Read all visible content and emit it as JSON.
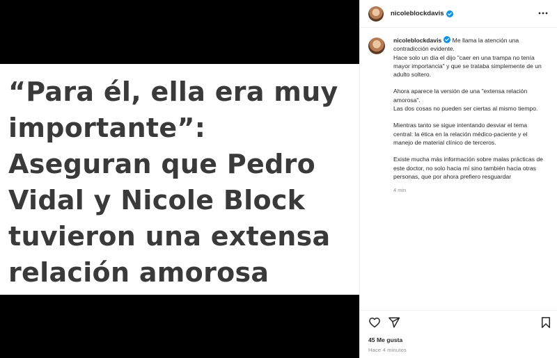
{
  "media": {
    "headline": "“Para él, ella era muy importante”: Aseguran que Pedro Vidal y Nicole Block tuvieron una extensa relación amorosa"
  },
  "header": {
    "username": "nicoleblockdavis"
  },
  "caption": {
    "username": "nicoleblockdavis",
    "lead": "Me llama la atención una contradicción evidente.",
    "lead_continuation": "Hace solo un día el dijo \"caer en una trampa no tenía mayor importancia\" y que se trataba simplemente de un adulto soltero.",
    "paragraphs": [
      "Ahora aparece la versión de una \"extensa relación amorosa\".\nLas dos cosas no pueden ser ciertas al mismo tiempo.",
      "Mientras tanto se sigue intentando desviar el tema central: la ética en la relación médico-paciente y el manejo de material clínico de terceros.",
      "Existe mucha más información sobre malas prácticas de este doctor, no solo hacia mí sino también hacia otras personas, que por ahora prefiero resguardar"
    ],
    "time": "4 min"
  },
  "footer": {
    "likes": "45 Me gusta",
    "posted": "Hace 4 minutos"
  },
  "icons": {
    "like": "heart-icon",
    "share": "paper-plane-icon",
    "save": "bookmark-icon",
    "more": "more-horizontal-icon",
    "verified": "verified-badge-icon"
  },
  "colors": {
    "verified": "#0095f6",
    "media_background": "#000000",
    "headline": "#3a3a3a",
    "muted": "#8e8e8e"
  }
}
